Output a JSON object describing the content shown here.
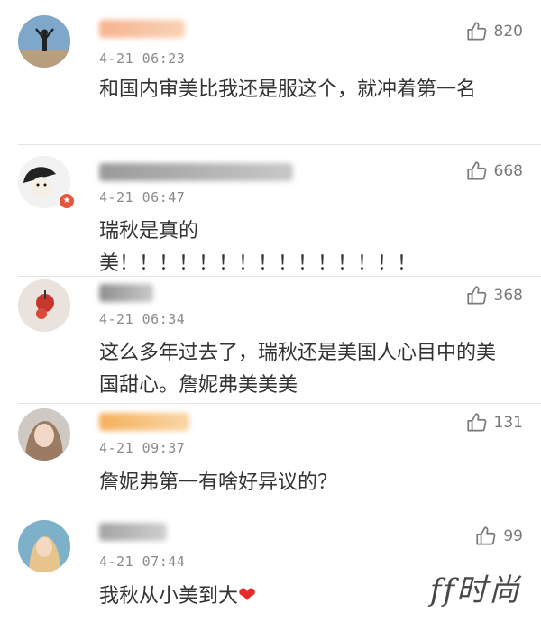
{
  "comments": [
    {
      "time": "4-21 06:23",
      "likes": "820",
      "text": "和国内审美比我还是服这个，就冲着第一名",
      "name_colors": [
        "#f6b38e",
        "#f9d2b6"
      ]
    },
    {
      "time": "4-21 06:47",
      "likes": "668",
      "text": "瑞秋是真的美！！！！！！！！！！！！！！！",
      "name_colors": [
        "#9a9a9a",
        "#c8c8c8"
      ],
      "vip": true
    },
    {
      "time": "4-21 06:34",
      "likes": "368",
      "text": "这么多年过去了，瑞秋还是美国人心目中的美国甜心。詹妮弗美美美",
      "name_colors": [
        "#8f8f8f",
        "#c9c9c9"
      ]
    },
    {
      "time": "4-21 09:37",
      "likes": "131",
      "text": "詹妮弗第一有啥好异议的？",
      "name_colors": [
        "#f4b05c",
        "#f9d6a6"
      ]
    },
    {
      "time": "4-21 07:44",
      "likes": "99",
      "text": "我秋从小美到大",
      "name_colors": [
        "#a3a3a3",
        "#cfcfcf"
      ],
      "has_heart": true
    }
  ],
  "watermark": "ff时尚",
  "colors": {
    "like": "#7a7a7a",
    "time": "#8a8a8a",
    "text": "#333333",
    "heart": "#e52b2b",
    "vip": "#e8553d"
  },
  "icons": {
    "like": "thumbs-up-icon",
    "heart": "heart-icon",
    "vip": "vip-badge-icon"
  }
}
